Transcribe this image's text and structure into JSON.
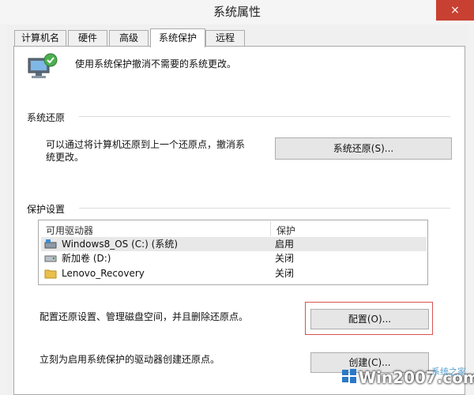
{
  "window": {
    "title": "系统属性",
    "close_label": "×"
  },
  "tabs": [
    {
      "label": "计算机名"
    },
    {
      "label": "硬件"
    },
    {
      "label": "高级"
    },
    {
      "label": "系统保护",
      "active": true
    },
    {
      "label": "远程"
    }
  ],
  "intro": {
    "text": "使用系统保护撤消不需要的系统更改。"
  },
  "restore": {
    "heading": "系统还原",
    "desc_line1": "可以通过将计算机还原到上一个还原点，撤消系",
    "desc_line2": "统更改。",
    "button": "系统还原(S)..."
  },
  "protection": {
    "heading": "保护设置",
    "columns": [
      "可用驱动器",
      "保护"
    ],
    "rows": [
      {
        "drive": "Windows8_OS (C:) (系统)",
        "status": "启用",
        "icon": "system-drive-icon"
      },
      {
        "drive": "新加卷 (D:)",
        "status": "关闭",
        "icon": "drive-icon"
      },
      {
        "drive": "Lenovo_Recovery",
        "status": "关闭",
        "icon": "folder-icon"
      }
    ],
    "config_desc": "配置还原设置、管理磁盘空间，并且删除还原点。",
    "config_button": "配置(O)...",
    "create_desc": "立刻为启用系统保护的驱动器创建还原点。",
    "create_button": "创建(C)..."
  },
  "watermark": {
    "text": "Win2007.com",
    "sub": "系统之家"
  },
  "colors": {
    "highlight_border": "#d9534f",
    "close_button": "#c84031",
    "folder": "#e8c04a"
  }
}
